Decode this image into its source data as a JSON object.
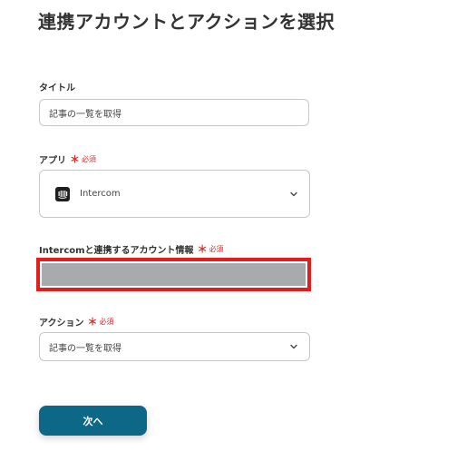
{
  "header": {
    "title": "連携アカウントとアクションを選択"
  },
  "form": {
    "title_field": {
      "label": "タイトル",
      "value": "記事の一覧を取得"
    },
    "app_field": {
      "label": "アプリ",
      "required_mark": "＊",
      "required_text": "必須",
      "value": "Intercom",
      "icon": "intercom-icon"
    },
    "account_field": {
      "label": "Intercomと連携するアカウント情報",
      "required_mark": "＊",
      "required_text": "必須"
    },
    "action_field": {
      "label": "アクション",
      "required_mark": "＊",
      "required_text": "必須",
      "value": "記事の一覧を取得"
    }
  },
  "footer": {
    "next_label": "次へ"
  },
  "colors": {
    "accent": "#0d6887",
    "required": "#e02b2b",
    "highlight_border": "#e31c1c",
    "masked_fill": "#a9aaad"
  }
}
